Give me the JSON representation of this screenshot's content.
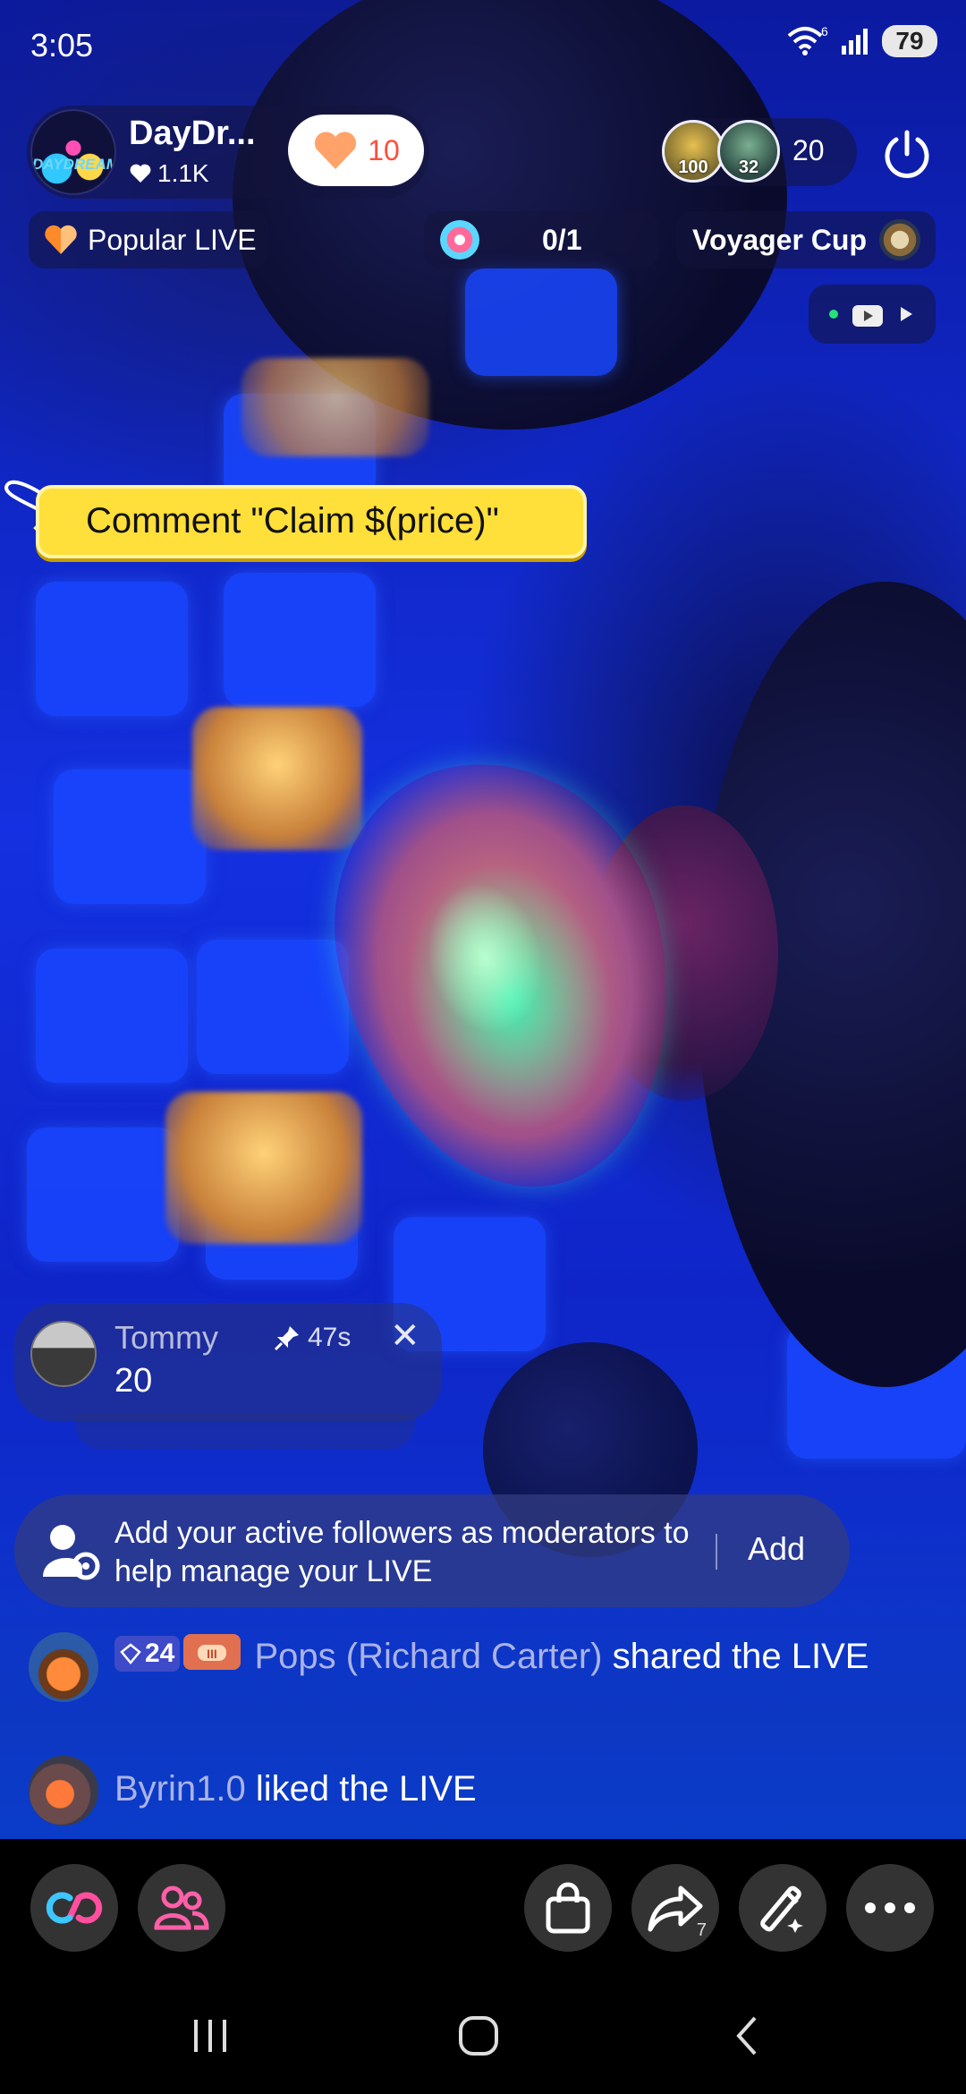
{
  "status_bar": {
    "time": "3:05",
    "wifi_badge": "6",
    "battery": "79"
  },
  "host": {
    "name": "DayDr...",
    "likes": "1.1K",
    "avatar_text": "DAYDREAM",
    "follow_count": "10"
  },
  "viewers": {
    "ranks": [
      "100",
      "32"
    ],
    "count": "20"
  },
  "chips": {
    "popular": "Popular LIVE",
    "progress": "0/1",
    "cup": "Voyager Cup"
  },
  "claim_banner": {
    "text": "Comment \"Claim $(price)\""
  },
  "pinned_comment": {
    "user": "Tommy",
    "time": "47s",
    "text": "20"
  },
  "moderator_tip": {
    "text": "Add your active followers as moderators to help manage your LIVE",
    "action": "Add"
  },
  "feed": [
    {
      "level": "24",
      "user": "Pops (Richard Carter)",
      "action": " shared the LIVE"
    },
    {
      "user": "Byrin1.0",
      "action": " liked the LIVE"
    }
  ],
  "action_bar": {
    "share_count": "7",
    "icons": [
      "link-icon",
      "co-host-icon",
      "shop-bag-icon",
      "share-icon",
      "magic-wand-icon",
      "more-icon"
    ]
  },
  "colors": {
    "accent": "#ff3d8e",
    "claim_yellow": "#ffdf3a",
    "follow_red": "#ff4d3c"
  }
}
